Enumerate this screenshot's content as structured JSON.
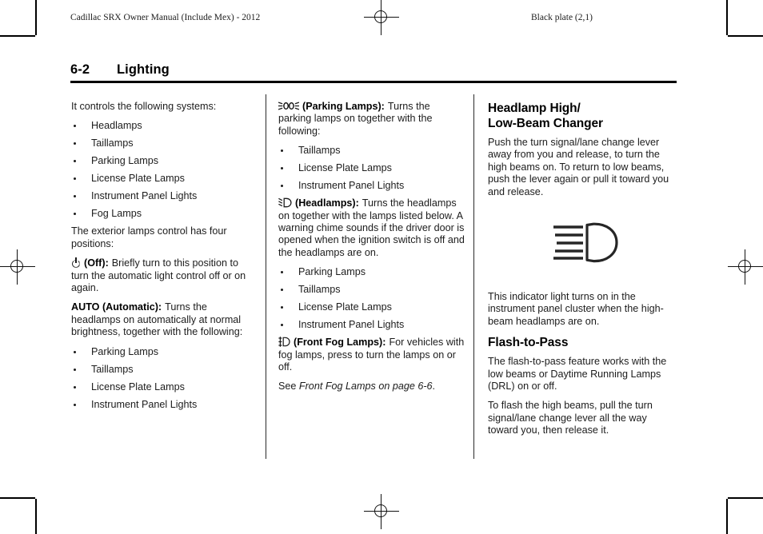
{
  "running_head": {
    "left": "Cadillac SRX Owner Manual (Include Mex) - 2012",
    "right": "Black plate (2,1)"
  },
  "page_title": {
    "number": "6-2",
    "section": "Lighting"
  },
  "column1": {
    "intro": "It controls the following systems:",
    "systems": [
      "Headlamps",
      "Taillamps",
      "Parking Lamps",
      "License Plate Lamps",
      "Instrument Panel Lights",
      "Fog Lamps"
    ],
    "positions_intro": "The exterior lamps control has four positions:",
    "off": {
      "icon": "power-off-icon",
      "term": "(Off):",
      "text": "Briefly turn to this position to turn the automatic light control off or on again."
    },
    "auto": {
      "term": "AUTO (Automatic):",
      "text": "Turns the headlamps on automatically at normal brightness, together with the following:",
      "items": [
        "Parking Lamps",
        "Taillamps",
        "License Plate Lamps",
        "Instrument Panel Lights"
      ]
    }
  },
  "column2": {
    "parking": {
      "icon": "parking-lamps-icon",
      "term": "(Parking Lamps):",
      "text": "Turns the parking lamps on together with the following:",
      "items": [
        "Taillamps",
        "License Plate Lamps",
        "Instrument Panel Lights"
      ]
    },
    "headlamps": {
      "icon": "headlamps-icon",
      "term": "(Headlamps):",
      "text": "Turns the headlamps on together with the lamps listed below. A warning chime sounds if the driver door is opened when the ignition switch is off and the headlamps are on.",
      "items": [
        "Parking Lamps",
        "Taillamps",
        "License Plate Lamps",
        "Instrument Panel Lights"
      ]
    },
    "fog": {
      "icon": "front-fog-lamps-icon",
      "term": "(Front Fog Lamps):",
      "text": "For vehicles with fog lamps, press to turn the lamps on or off."
    },
    "cross_reference": {
      "prefix": "See",
      "link": "Front Fog Lamps on page 6-6",
      "suffix": "."
    }
  },
  "column3": {
    "heading1_line1": "Headlamp High/",
    "heading1_line2": "Low-Beam Changer",
    "paragraph1": "Push the turn signal/lane change lever away from you and release, to turn the high beams on. To return to low beams, push the lever again or pull it toward you and release.",
    "figure_icon": "high-beam-indicator-icon",
    "paragraph2": "This indicator light turns on in the instrument panel cluster when the high-beam headlamps are on.",
    "heading2": "Flash-to-Pass",
    "paragraph3": "The flash-to-pass feature works with the low beams or Daytime Running Lamps (DRL) on or off.",
    "paragraph4": "To flash the high beams, pull the turn signal/lane change lever all the way toward you, then release it."
  }
}
